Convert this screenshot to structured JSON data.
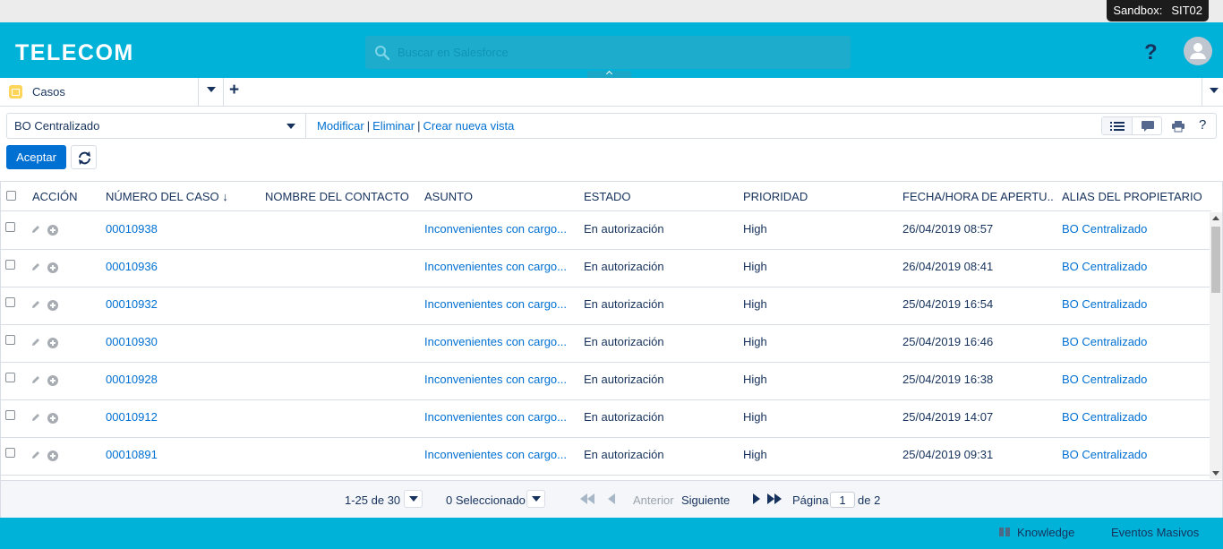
{
  "sandbox": {
    "label": "Sandbox:",
    "name": "SIT02"
  },
  "header": {
    "logo": "TELECOM",
    "search_placeholder": "Buscar en Salesforce",
    "help_label": "?"
  },
  "tabs": [
    {
      "label": "Casos",
      "icon": "folder-icon"
    }
  ],
  "tab_add_label": "+",
  "list_view": {
    "selected": "BO Centralizado",
    "links": [
      "Modificar",
      "Eliminar",
      "Crear nueva vista"
    ],
    "help_label": "?"
  },
  "actions": {
    "accept_label": "Aceptar"
  },
  "table": {
    "columns": [
      "Acción",
      "Número del caso ↓",
      "Nombre del contacto",
      "Asunto",
      "Estado",
      "Prioridad",
      "Fecha/Hora de apertu...",
      "Alias del propietario ..."
    ],
    "rows": [
      {
        "case": "00010938",
        "contact": "",
        "subject": "Inconvenientes con cargo...",
        "status": "En autorización",
        "priority": "High",
        "opened": "26/04/2019 08:57",
        "owner": "BO Centralizado"
      },
      {
        "case": "00010936",
        "contact": "",
        "subject": "Inconvenientes con cargo...",
        "status": "En autorización",
        "priority": "High",
        "opened": "26/04/2019 08:41",
        "owner": "BO Centralizado"
      },
      {
        "case": "00010932",
        "contact": "",
        "subject": "Inconvenientes con cargo...",
        "status": "En autorización",
        "priority": "High",
        "opened": "25/04/2019 16:54",
        "owner": "BO Centralizado"
      },
      {
        "case": "00010930",
        "contact": "",
        "subject": "Inconvenientes con cargo...",
        "status": "En autorización",
        "priority": "High",
        "opened": "25/04/2019 16:46",
        "owner": "BO Centralizado"
      },
      {
        "case": "00010928",
        "contact": "",
        "subject": "Inconvenientes con cargo...",
        "status": "En autorización",
        "priority": "High",
        "opened": "25/04/2019 16:38",
        "owner": "BO Centralizado"
      },
      {
        "case": "00010912",
        "contact": "",
        "subject": "Inconvenientes con cargo...",
        "status": "En autorización",
        "priority": "High",
        "opened": "25/04/2019 14:07",
        "owner": "BO Centralizado"
      },
      {
        "case": "00010891",
        "contact": "",
        "subject": "Inconvenientes con cargo...",
        "status": "En autorización",
        "priority": "High",
        "opened": "25/04/2019 09:31",
        "owner": "BO Centralizado"
      }
    ]
  },
  "pager": {
    "range": "1-25 de 30",
    "selected": "0 Seleccionado",
    "prev": "Anterior",
    "next": "Siguiente",
    "page_label": "Página",
    "page_value": "1",
    "of_label": "de 2"
  },
  "footer": {
    "items": [
      "Knowledge",
      "Eventos Masivos"
    ]
  },
  "colors": {
    "brand": "#00b2d8",
    "link": "#0070d2",
    "text": "#16325c"
  }
}
